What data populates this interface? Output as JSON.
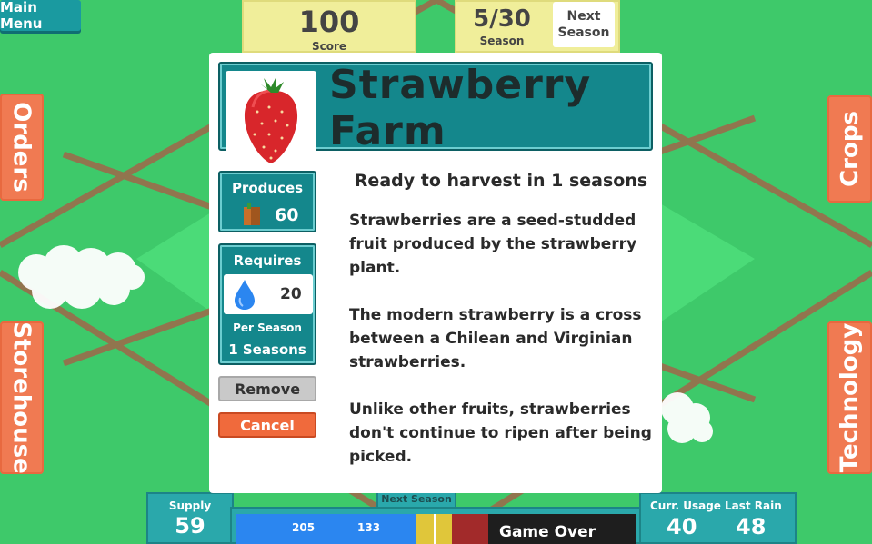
{
  "main_menu_label": "Main Menu",
  "score": {
    "value": "100",
    "label": "Score"
  },
  "season": {
    "value": "5/30",
    "label": "Season"
  },
  "next_season_button": "Next Season",
  "side_tabs": {
    "orders": "Orders",
    "storehouse": "Storehouse",
    "crops": "Crops",
    "technology": "Technology"
  },
  "modal": {
    "title": "Strawberry Farm",
    "produces": {
      "label": "Produces",
      "value": "60"
    },
    "requires": {
      "label": "Requires",
      "water": "20",
      "per_season": "Per Season",
      "seasons": "1 Seasons"
    },
    "remove_label": "Remove",
    "cancel_label": "Cancel",
    "harvest_text": "Ready to harvest in 1 seasons",
    "paragraphs": [
      "Strawberries are a seed-studded fruit produced by the strawberry plant.",
      "The modern strawberry is a cross between a Chilean and Virginian strawberries.",
      "Unlike other fruits, strawberries don't continue to ripen after being picked."
    ]
  },
  "bottom": {
    "supply": {
      "label": "Supply",
      "value": "59"
    },
    "next_season_label": "Next Season",
    "bar_values": [
      "205",
      "133"
    ],
    "game_over": "Game Over",
    "curr_usage": {
      "label": "Curr. Usage",
      "value": "40"
    },
    "last_rain": {
      "label": "Last Rain",
      "value": "48"
    }
  },
  "colors": {
    "teal": "#14878c",
    "orange": "#f07a52",
    "yellow": "#f0ee9a",
    "field_green": "#3ec96a",
    "water_blue": "#2b86f0"
  }
}
